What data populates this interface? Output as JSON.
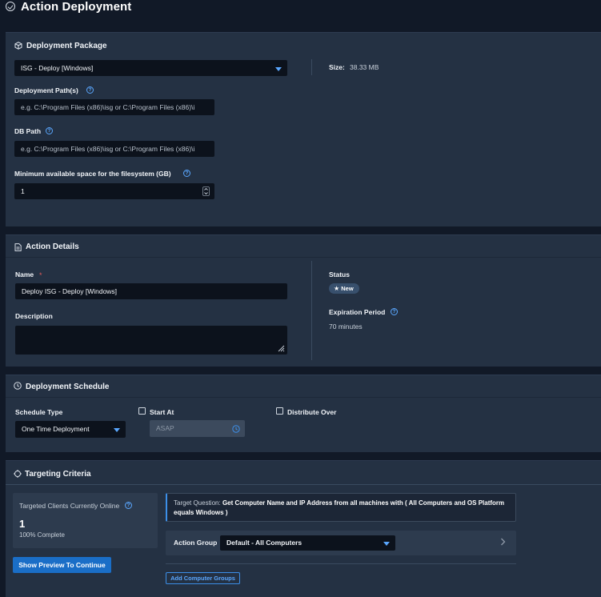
{
  "page": {
    "title": "Action Deployment"
  },
  "deployment_package": {
    "title": "Deployment Package",
    "package_select": "ISG - Deploy [Windows]",
    "size_label": "Size:",
    "size_value": "38.33 MB",
    "deployment_paths_label": "Deployment Path(s)",
    "deployment_paths_placeholder": "e.g. C:\\Program Files (x86)\\isg or C:\\Program Files (x86)\\i",
    "db_path_label": "DB Path",
    "db_path_placeholder": "e.g. C:\\Program Files (x86)\\isg or C:\\Program Files (x86)\\i",
    "min_space_label": "Minimum available space for the filesystem (GB)",
    "min_space_value": "1"
  },
  "action_details": {
    "title": "Action Details",
    "name_label": "Name",
    "required_mark": "*",
    "name_value": "Deploy ISG - Deploy [Windows]",
    "description_label": "Description",
    "description_value": "",
    "status_label": "Status",
    "status_badge": "New",
    "expiration_label": "Expiration Period",
    "expiration_value": "70 minutes"
  },
  "deployment_schedule": {
    "title": "Deployment Schedule",
    "schedule_type_label": "Schedule Type",
    "schedule_type_value": "One Time Deployment",
    "start_at_label": "Start At",
    "start_at_value": "ASAP",
    "distribute_over_label": "Distribute Over"
  },
  "targeting_criteria": {
    "title": "Targeting Criteria",
    "clients_label": "Targeted Clients Currently Online",
    "clients_count": "1",
    "clients_complete": "100% Complete",
    "preview_button": "Show Preview To Continue",
    "target_question_prefix": "Target Question:",
    "target_question_text": "Get Computer Name and IP Address from all machines with ( All Computers and OS Platform equals Windows )",
    "action_group_label": "Action Group",
    "action_group_value": "Default - All Computers",
    "add_groups_button": "Add Computer Groups"
  },
  "colors": {
    "background": "#111927",
    "card": "#243143",
    "input": "#0c121c",
    "accent": "#1a6ec7",
    "link": "#5aa7ff",
    "required": "#e05a5a"
  }
}
